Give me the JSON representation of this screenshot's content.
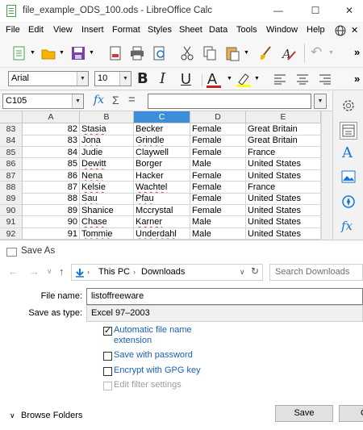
{
  "calc": {
    "window_title": "file_example_ODS_100.ods - LibreOffice Calc",
    "menu": [
      "File",
      "Edit",
      "View",
      "Insert",
      "Format",
      "Styles",
      "Sheet",
      "Data",
      "Tools",
      "Window",
      "Help"
    ],
    "font_name": "Arial",
    "font_size": "10",
    "name_box": "C105",
    "formula_symbols": {
      "function": "fx",
      "sum": "Σ",
      "equals": "="
    },
    "columns": [
      "A",
      "B",
      "C",
      "D",
      "E"
    ],
    "selected_column": "C",
    "rows": [
      {
        "row": "83",
        "id": "82",
        "first": "Stasia",
        "last": "Becker",
        "gender": "Female",
        "country": "Great Britain"
      },
      {
        "row": "84",
        "id": "83",
        "first": "Jona",
        "last": "Grindle",
        "gender": "Female",
        "country": "Great Britain"
      },
      {
        "row": "85",
        "id": "84",
        "first": "Judie",
        "last": "Claywell",
        "gender": "Female",
        "country": "France"
      },
      {
        "row": "86",
        "id": "85",
        "first": "Dewitt",
        "last": "Borger",
        "gender": "Male",
        "country": "United States"
      },
      {
        "row": "87",
        "id": "86",
        "first": "Nena",
        "last": "Hacker",
        "gender": "Female",
        "country": "United States"
      },
      {
        "row": "88",
        "id": "87",
        "first": "Kelsie",
        "last": "Wachtel",
        "gender": "Female",
        "country": "France"
      },
      {
        "row": "89",
        "id": "88",
        "first": "Sau",
        "last": "Pfau",
        "gender": "Female",
        "country": "United States"
      },
      {
        "row": "90",
        "id": "89",
        "first": "Shanice",
        "last": "Mccrystal",
        "gender": "Female",
        "country": "United States"
      },
      {
        "row": "91",
        "id": "90",
        "first": "Chase",
        "last": "Karner",
        "gender": "Male",
        "country": "United States"
      },
      {
        "row": "92",
        "id": "91",
        "first": "Tommie",
        "last": "Underdahl",
        "gender": "Male",
        "country": "United States"
      }
    ],
    "accent_color": "#3c8ed8"
  },
  "dialog": {
    "title": "Save As",
    "breadcrumb": [
      "This PC",
      "Downloads"
    ],
    "search_placeholder": "Search Downloads",
    "file_name_label": "File name:",
    "file_name_value": "listoffreeware",
    "save_type_label": "Save as type:",
    "save_type_value": "Excel 97–2003",
    "options": [
      {
        "label": "Automatic file name extension",
        "checked": true,
        "disabled": false
      },
      {
        "label": "Save with password",
        "checked": false,
        "disabled": false
      },
      {
        "label": "Encrypt with GPG key",
        "checked": false,
        "disabled": false
      },
      {
        "label": "Edit filter settings",
        "checked": false,
        "disabled": true
      }
    ],
    "option_line1": "Automatic file name",
    "option_line2": "extension",
    "browse_folders": "Browse Folders",
    "save_button": "Save",
    "cancel_button": "C"
  }
}
